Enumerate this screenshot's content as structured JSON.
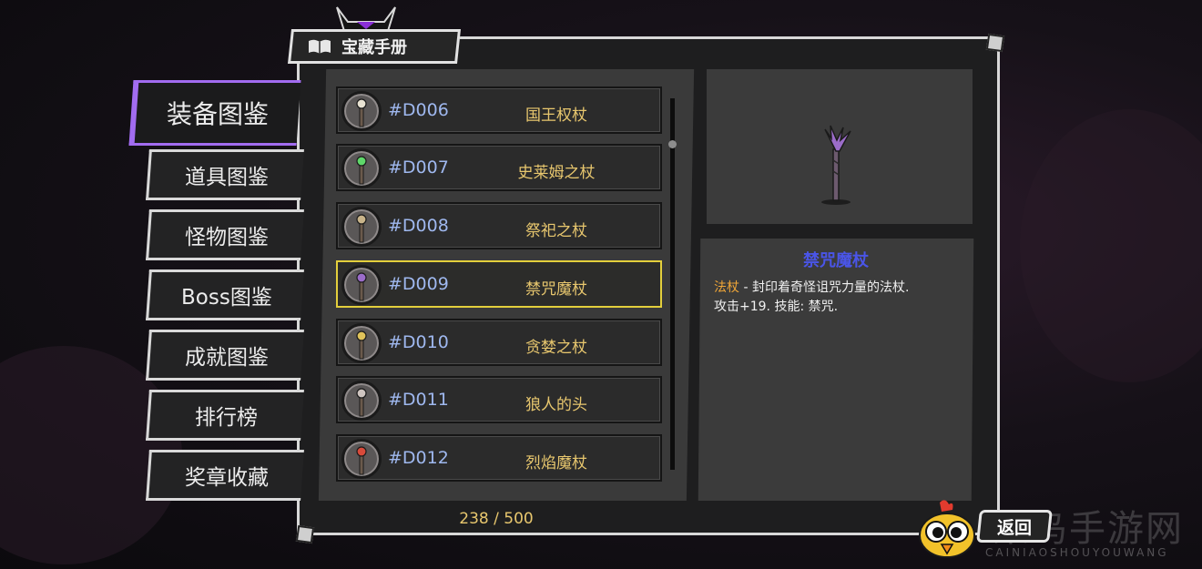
{
  "window": {
    "title": "宝藏手册"
  },
  "sidebar": {
    "items": [
      {
        "label": "装备图鉴",
        "active": true
      },
      {
        "label": "道具图鉴",
        "active": false
      },
      {
        "label": "怪物图鉴",
        "active": false
      },
      {
        "label": "Boss图鉴",
        "active": false
      },
      {
        "label": "成就图鉴",
        "active": false
      },
      {
        "label": "排行榜",
        "active": false
      },
      {
        "label": "奖章收藏",
        "active": false
      }
    ]
  },
  "list": {
    "items": [
      {
        "code": "#D006",
        "name": "国王权杖",
        "icon": "king-scepter-icon",
        "gem": "#e8e2d2"
      },
      {
        "code": "#D007",
        "name": "史莱姆之杖",
        "icon": "slime-staff-icon",
        "gem": "#5fd86a"
      },
      {
        "code": "#D008",
        "name": "祭祀之杖",
        "icon": "ritual-staff-icon",
        "gem": "#c9b48a"
      },
      {
        "code": "#D009",
        "name": "禁咒魔杖",
        "icon": "forbidden-staff-icon",
        "gem": "#9b6cc9"
      },
      {
        "code": "#D010",
        "name": "贪婪之杖",
        "icon": "greed-staff-icon",
        "gem": "#e0c35a"
      },
      {
        "code": "#D011",
        "name": "狼人的头",
        "icon": "werewolf-head-icon",
        "gem": "#cfc5c0"
      },
      {
        "code": "#D012",
        "name": "烈焰魔杖",
        "icon": "flame-staff-icon",
        "gem": "#d84a3a"
      }
    ],
    "selected_index": 3,
    "counter": "238 / 500"
  },
  "detail": {
    "title": "禁咒魔杖",
    "type": "法杖",
    "description": " - 封印着奇怪诅咒力量的法杖.",
    "stats": "攻击+19. 技能: 禁咒.",
    "preview_icon": "forbidden-staff-icon"
  },
  "footer": {
    "back_label": "返回"
  },
  "watermark": {
    "text": "菜鸟手游网",
    "sub": "CAINIAOSHOUYOUWANG"
  },
  "colors": {
    "accent_purple": "#a26cf0",
    "selected_border": "#e3cf3c",
    "item_name": "#e8c76e",
    "item_code": "#9fb8ef",
    "detail_title": "#4a55e8",
    "type_label": "#f0a637"
  }
}
